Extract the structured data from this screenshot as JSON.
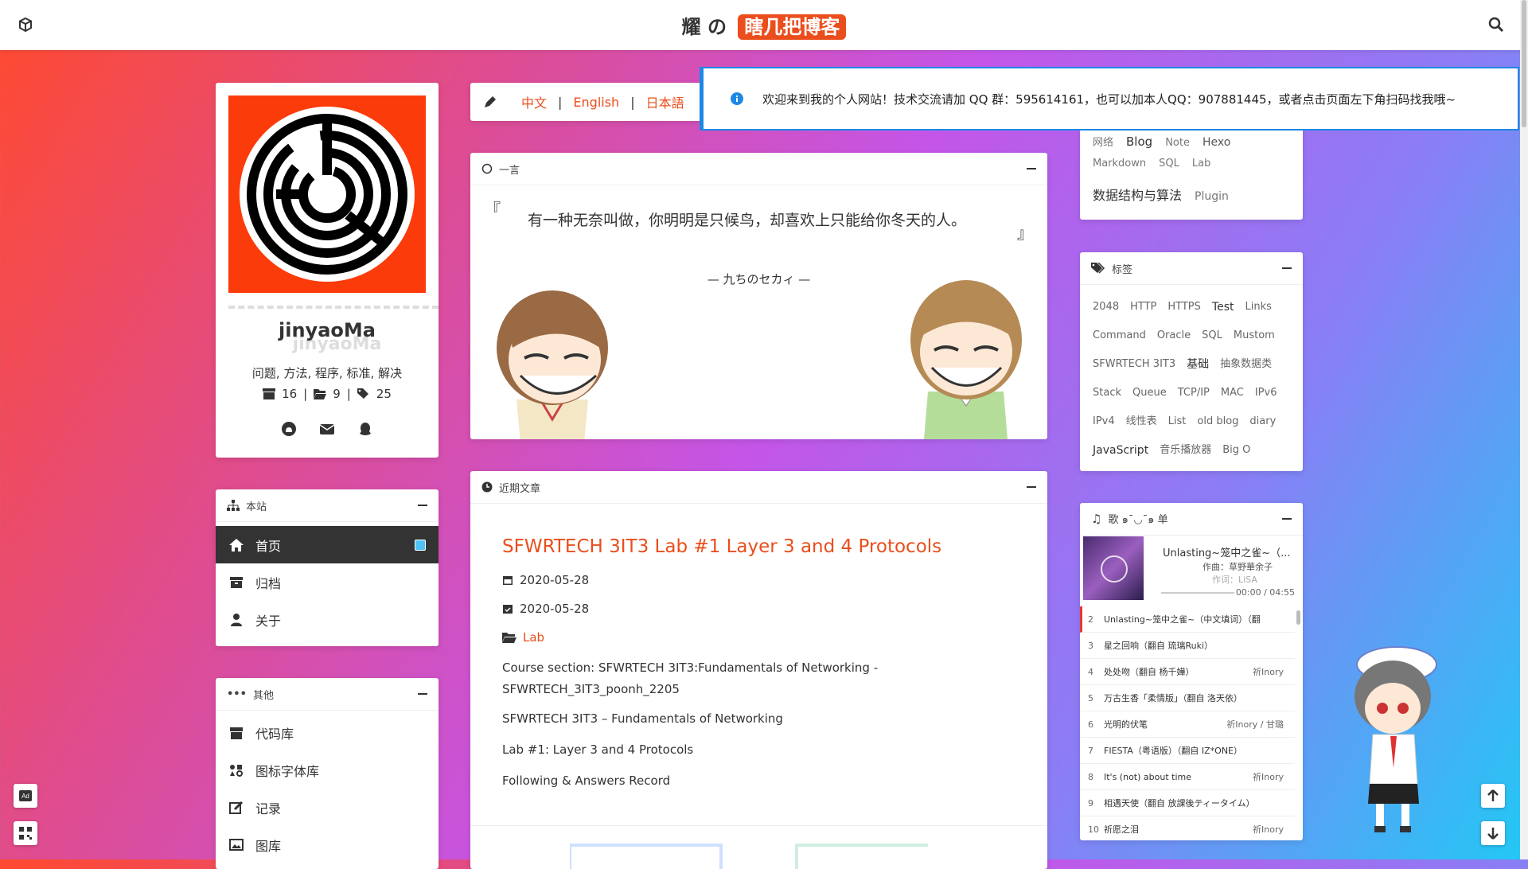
{
  "header": {
    "title_prefix": "耀 の",
    "title_highlight": "瞎几把博客"
  },
  "profile": {
    "name": "jinyaoMa",
    "name_shadow": "jinyaoMa",
    "description": "问题, 方法, 程序, 标准, 解决",
    "posts_count": "16",
    "categories_count": "9",
    "tags_count": "25",
    "sep": "|"
  },
  "nav": {
    "title": "本站",
    "items": [
      {
        "label": "首页",
        "icon": "home-icon"
      },
      {
        "label": "归档",
        "icon": "archive-icon"
      },
      {
        "label": "关于",
        "icon": "user-icon"
      }
    ]
  },
  "other": {
    "title": "其他",
    "items": [
      {
        "label": "代码库",
        "icon": "box-icon"
      },
      {
        "label": "图标字体库",
        "icon": "icons-icon"
      },
      {
        "label": "记录",
        "icon": "edit-icon"
      },
      {
        "label": "图库",
        "icon": "images-icon"
      }
    ]
  },
  "lang": {
    "zh": "中文",
    "en": "English",
    "ja": "日本語",
    "sep": "|"
  },
  "notice": {
    "text": "欢迎来到我的个人网站！技术交流请加 QQ 群：595614161，也可以加本人QQ：907881445，或者点击页面左下角扫码找我哦~"
  },
  "hitokoto": {
    "title": "一言",
    "open_quote": "『",
    "close_quote": "』",
    "quote": "有一种无奈叫做，你明明是只候鸟，却喜欢上只能给你冬天的人。",
    "from": "— 九ちのセカィ —"
  },
  "recent": {
    "title": "近期文章",
    "post": {
      "title": "SFWRTECH 3IT3 Lab #1 Layer 3 and 4 Protocols",
      "created": "2020-05-28",
      "updated": "2020-05-28",
      "category": "Lab",
      "paragraphs": [
        "Course section: SFWRTECH 3IT3:Fundamentals of Networking - SFWRTECH_3IT3_poonh_2205",
        "SFWRTECH 3IT3 – Fundamentals of Networking",
        "Lab #1: Layer 3 and 4 Protocols",
        "Following & Answers Record"
      ]
    }
  },
  "categories": {
    "row1": [
      "网络",
      "Blog",
      "Note",
      "Hexo"
    ],
    "row2": [
      "Markdown",
      "SQL",
      "Lab"
    ],
    "row3": [
      "数据结构与算法",
      "Plugin"
    ]
  },
  "tags": {
    "title": "标签",
    "items": [
      "2048",
      "HTTP",
      "HTTPS",
      "Test",
      "Links",
      "Command",
      "Oracle",
      "SQL",
      "Mustom",
      "SFWRTECH 3IT3",
      "基础",
      "抽象数据类",
      "Stack",
      "Queue",
      "TCP/IP",
      "MAC",
      "IPv6",
      "IPv4",
      "线性表",
      "List",
      "old blog",
      "diary",
      "JavaScript",
      "音乐播放器",
      "Big O"
    ]
  },
  "music": {
    "title": "歌 ๑¯◡¯๑ 单",
    "now_title": "Unlasting~笼中之雀~（...",
    "now_artist": "作曲：草野華余子",
    "now_lyric": "作词：LiSA",
    "time": "00:00 / 04:55",
    "list": [
      {
        "n": "2",
        "t": "Unlasting~笼中之雀~（中文填词）（翻",
        "a": ""
      },
      {
        "n": "3",
        "t": "星之回响（翻自 琉璃Ruki）",
        "a": ""
      },
      {
        "n": "4",
        "t": "处处吻（翻自 杨千嬅）",
        "a": "祈Inory"
      },
      {
        "n": "5",
        "t": "万古生香「柔情版」（翻自 洛天依）",
        "a": ""
      },
      {
        "n": "6",
        "t": "光明的伏笔",
        "a": "祈Inory / 甘璐"
      },
      {
        "n": "7",
        "t": "FIESTA（粤语版）（翻自 IZ*ONE）",
        "a": ""
      },
      {
        "n": "8",
        "t": "It's (not) about time",
        "a": "祈Inory"
      },
      {
        "n": "9",
        "t": "相遇天使（翻自 放課後ティータイム）",
        "a": ""
      },
      {
        "n": "10",
        "t": "祈愿之泪",
        "a": "祈Inory"
      }
    ]
  }
}
